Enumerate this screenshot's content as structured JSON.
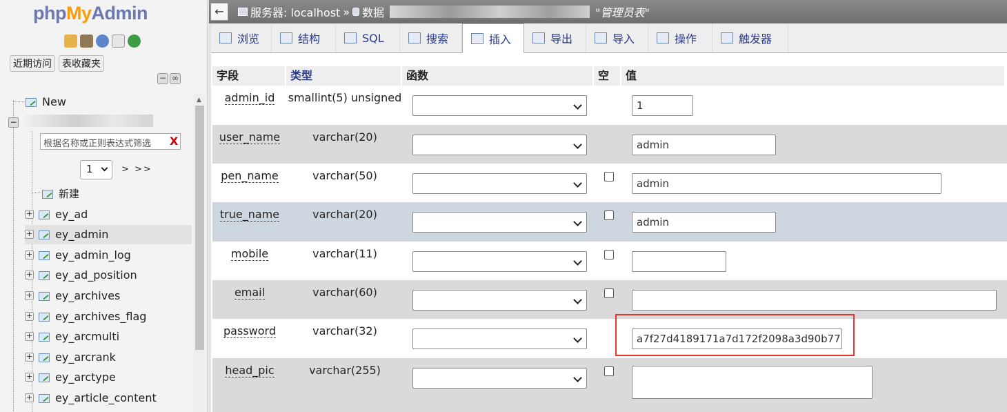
{
  "logo": {
    "php": "php",
    "my": "My",
    "admin": "Admin"
  },
  "sidebar": {
    "recent_label": "近期访问",
    "favorites_label": "表收藏夹",
    "new_label": "New",
    "filter_placeholder": "根据名称或正则表达式筛选",
    "filter_clear": "X",
    "page_value": "1",
    "pager_text": "> >>",
    "new_table_label": "新建",
    "tables": [
      "ey_ad",
      "ey_admin",
      "ey_admin_log",
      "ey_ad_position",
      "ey_archives",
      "ey_archives_flag",
      "ey_arcmulti",
      "ey_arcrank",
      "ey_arctype",
      "ey_article_content"
    ],
    "selected_table": "ey_admin"
  },
  "breadcrumb": {
    "back": "←",
    "server": "服务器: localhost",
    "sep": "»",
    "database_prefix": "数据",
    "table_comment": "\"管理员表\""
  },
  "tabs": [
    {
      "label": "浏览",
      "icon": "browse-icon"
    },
    {
      "label": "结构",
      "icon": "structure-icon"
    },
    {
      "label": "SQL",
      "icon": "sql-icon"
    },
    {
      "label": "搜索",
      "icon": "search-icon"
    },
    {
      "label": "插入",
      "icon": "insert-icon",
      "active": true
    },
    {
      "label": "导出",
      "icon": "export-icon"
    },
    {
      "label": "导入",
      "icon": "import-icon"
    },
    {
      "label": "操作",
      "icon": "wrench-icon"
    },
    {
      "label": "触发器",
      "icon": "trigger-icon"
    }
  ],
  "columns": {
    "field": "字段",
    "type": "类型",
    "function": "函数",
    "null": "空",
    "value": "值"
  },
  "rows": [
    {
      "field": "admin_id",
      "type": "smallint(5) unsigned",
      "value": "1",
      "has_null": false
    },
    {
      "field": "user_name",
      "type": "varchar(20)",
      "value": "admin",
      "has_null": false
    },
    {
      "field": "pen_name",
      "type": "varchar(50)",
      "value": "admin",
      "has_null": true
    },
    {
      "field": "true_name",
      "type": "varchar(20)",
      "value": "admin",
      "has_null": true
    },
    {
      "field": "mobile",
      "type": "varchar(11)",
      "value": "",
      "has_null": true
    },
    {
      "field": "email",
      "type": "varchar(60)",
      "value": "",
      "has_null": true
    },
    {
      "field": "password",
      "type": "varchar(32)",
      "value": "a7f27d4189171a7d172f2098a3d90b77",
      "has_null": false
    },
    {
      "field": "head_pic",
      "type": "varchar(255)",
      "value": "",
      "has_null": true
    }
  ],
  "colors": {
    "tab_text": "#2a3a8f",
    "highlight": "#e2362f",
    "row_hover": "#ced6e0"
  }
}
